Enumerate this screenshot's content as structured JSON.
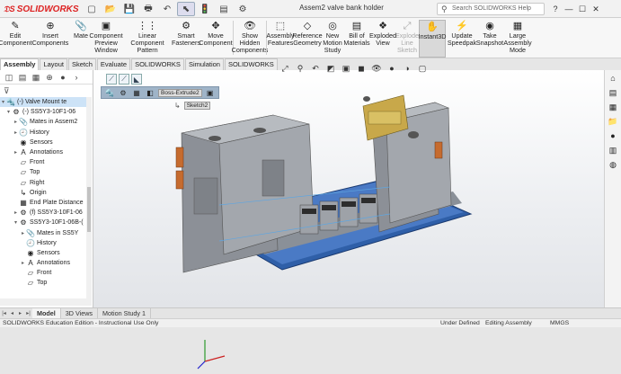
{
  "app": {
    "logo_text": "SOLIDWORKS",
    "document_title": "Assem2 valve bank holder",
    "search_placeholder": "Search SOLIDWORKS Help"
  },
  "quick_access": [
    "new-icon",
    "open-icon",
    "save-icon",
    "print-icon",
    "undo-icon",
    "select-icon",
    "rebuild-icon",
    "file-properties-icon",
    "options-icon"
  ],
  "title_icons": [
    "?",
    "—",
    "☐",
    "✕"
  ],
  "ribbon": {
    "buttons": [
      {
        "label": "Edit Component",
        "icon": "✎"
      },
      {
        "label": "Insert Components",
        "icon": "⊕"
      },
      {
        "label": "Mate",
        "icon": "📎"
      },
      {
        "label": "Component Preview Window",
        "icon": "▣"
      },
      {
        "label": "Linear Component Pattern",
        "icon": "⋮⋮"
      },
      {
        "label": "Smart Fasteners",
        "icon": "⚙"
      },
      {
        "label": "Move Component",
        "icon": "✥"
      },
      {
        "label": "Show Hidden Components",
        "icon": "👁"
      },
      {
        "label": "Assembly Features",
        "icon": "⬚"
      },
      {
        "label": "Reference Geometry",
        "icon": "◇"
      },
      {
        "label": "New Motion Study",
        "icon": "◎"
      },
      {
        "label": "Bill of Materials",
        "icon": "▤"
      },
      {
        "label": "Exploded View",
        "icon": "❖"
      },
      {
        "label": "Explode Line Sketch",
        "icon": "⤢"
      },
      {
        "label": "Instant3D",
        "icon": "✋"
      },
      {
        "label": "Update Speedpak",
        "icon": "⚡"
      },
      {
        "label": "Take Snapshot",
        "icon": "◉"
      },
      {
        "label": "Large Assembly Mode",
        "icon": "▦"
      }
    ]
  },
  "tabs": [
    "Assembly",
    "Layout",
    "Sketch",
    "Evaluate",
    "SOLIDWORKS Add-Ins",
    "Simulation",
    "SOLIDWORKS MBD"
  ],
  "tree": [
    {
      "label": "(-) Valve Mount te",
      "icon": "🔩",
      "arrow": "▾",
      "hl": true
    },
    {
      "label": "(-) SS5Y3-10F1-06",
      "icon": "⚙",
      "arrow": "▾",
      "hl": false
    },
    {
      "label": "Mates in Assem2",
      "icon": "📎",
      "arrow": "▸",
      "hl": false
    },
    {
      "label": "History",
      "icon": "🕘",
      "arrow": "▸",
      "hl": false
    },
    {
      "label": "Sensors",
      "icon": "◉",
      "arrow": "",
      "hl": false
    },
    {
      "label": "Annotations",
      "icon": "A",
      "arrow": "▸",
      "hl": false
    },
    {
      "label": "Front",
      "icon": "▱",
      "arrow": "",
      "hl": false
    },
    {
      "label": "Top",
      "icon": "▱",
      "arrow": "",
      "hl": false
    },
    {
      "label": "Right",
      "icon": "▱",
      "arrow": "",
      "hl": false
    },
    {
      "label": "Origin",
      "icon": "↳",
      "arrow": "",
      "hl": false
    },
    {
      "label": "End Plate Distance",
      "icon": "▦",
      "arrow": "",
      "hl": false
    },
    {
      "label": "(f) SS5Y3-10F1-06",
      "icon": "⚙",
      "arrow": "▸",
      "hl": false
    },
    {
      "label": "SS5Y3-10F1-06B-(",
      "icon": "⚙",
      "arrow": "▾",
      "hl": false
    },
    {
      "label": "Mates in SS5Y",
      "icon": "📎",
      "arrow": "▸",
      "hl": false
    },
    {
      "label": "History",
      "icon": "🕘",
      "arrow": "",
      "hl": false
    },
    {
      "label": "Sensors",
      "icon": "◉",
      "arrow": "",
      "hl": false
    },
    {
      "label": "Annotations",
      "icon": "A",
      "arrow": "▸",
      "hl": false
    },
    {
      "label": "Front",
      "icon": "▱",
      "arrow": "",
      "hl": false
    },
    {
      "label": "Top",
      "icon": "▱",
      "arrow": "",
      "hl": false
    }
  ],
  "breadcrumb": {
    "feature": "Boss-Extrude2",
    "sketch": "Sketch2"
  },
  "bottom_tabs": [
    "Model",
    "3D Views",
    "Motion Study 1"
  ],
  "status": {
    "edition": "SOLIDWORKS Education Edition - Instructional Use Only",
    "state": "Under Defined",
    "mode": "Editing Assembly",
    "units": "MMGS"
  }
}
